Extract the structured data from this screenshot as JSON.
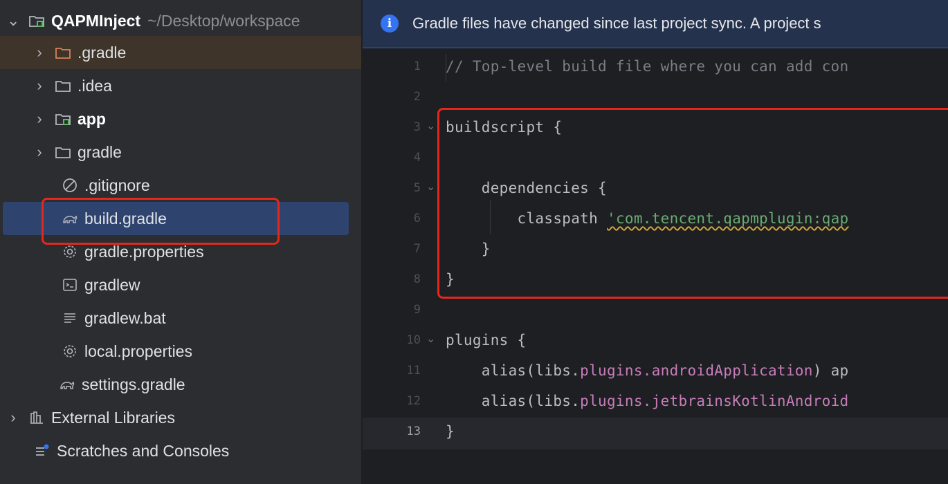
{
  "project": {
    "name": "QAPMInject",
    "path": "~/Desktop/workspace"
  },
  "tree": [
    {
      "label": ".gradle",
      "icon": "folder-icon"
    },
    {
      "label": ".idea",
      "icon": "folder-icon"
    },
    {
      "label": "app",
      "icon": "module-folder-icon"
    },
    {
      "label": "gradle",
      "icon": "folder-icon"
    },
    {
      "label": ".gitignore",
      "icon": "ignore-file-icon"
    },
    {
      "label": "build.gradle",
      "icon": "gradle-elephant-icon"
    },
    {
      "label": "gradle.properties",
      "icon": "settings-gear-icon"
    },
    {
      "label": "gradlew",
      "icon": "terminal-script-icon"
    },
    {
      "label": "gradlew.bat",
      "icon": "text-lines-icon"
    },
    {
      "label": "local.properties",
      "icon": "settings-gear-icon"
    },
    {
      "label": "settings.gradle",
      "icon": "gradle-elephant-icon"
    },
    {
      "label": "External Libraries",
      "icon": "libraries-icon"
    },
    {
      "label": "Scratches and Consoles",
      "icon": "scratches-icon"
    }
  ],
  "banner": {
    "icon": "info-icon",
    "text": "Gradle files have changed since last project sync. A project s"
  },
  "editor": {
    "current_line": "13",
    "lines": [
      {
        "num": "1",
        "text": "// Top-level build file where you can add con"
      },
      {
        "num": "2",
        "text": ""
      },
      {
        "num": "3",
        "text": "buildscript {"
      },
      {
        "num": "4",
        "text": ""
      },
      {
        "num": "5",
        "text": "    dependencies {"
      },
      {
        "num": "6",
        "text": "        classpath 'com.tencent.qapmplugin:qap"
      },
      {
        "num": "7",
        "text": "    }"
      },
      {
        "num": "8",
        "text": "}"
      },
      {
        "num": "9",
        "text": ""
      },
      {
        "num": "10",
        "text": "plugins {"
      },
      {
        "num": "11",
        "text": "    alias(libs.plugins.androidApplication) ap"
      },
      {
        "num": "12",
        "text": "    alias(libs.plugins.jetbrainsKotlinAndroid"
      },
      {
        "num": "13",
        "text": "}"
      }
    ],
    "tokens": {
      "l6_keyword": "classpath",
      "l6_string": "'com.tencent.qapmplugin:qap",
      "alias_call": "alias(libs.",
      "plugins_prop": "plugins",
      "app_prop": ".androidApplication",
      "app_tail": ") ap",
      "kotlin_prop": ".jetbrainsKotlinAndroid"
    }
  },
  "colors": {
    "highlight_box": "#e2281c",
    "selection": "#2e436e",
    "banner_bg": "#25324d",
    "accent": "#3574f0"
  }
}
